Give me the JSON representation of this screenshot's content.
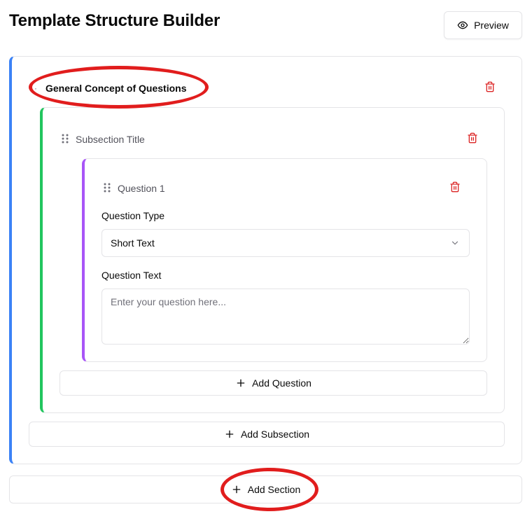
{
  "header": {
    "title": "Template Structure Builder",
    "preview_label": "Preview"
  },
  "section": {
    "title": "General Concept of Questions",
    "bullet": "·",
    "add_subsection_label": "Add Subsection"
  },
  "subsection": {
    "title_placeholder": "Subsection Title",
    "add_question_label": "Add Question"
  },
  "question": {
    "title_placeholder": "Question 1",
    "type_label": "Question Type",
    "type_value": "Short Text",
    "text_label": "Question Text",
    "text_placeholder": "Enter your question here...",
    "text_value": ""
  },
  "footer": {
    "add_section_label": "Add Section"
  },
  "colors": {
    "section_accent": "#3b82f6",
    "subsection_accent": "#22c55e",
    "question_accent": "#a855f7",
    "delete": "#dc2626",
    "annotation": "#e11d1d"
  },
  "icons": {
    "preview": "eye-icon",
    "delete": "trash-icon",
    "drag": "grip-vertical-icon",
    "dropdown": "chevron-down-icon",
    "add": "plus-icon"
  }
}
